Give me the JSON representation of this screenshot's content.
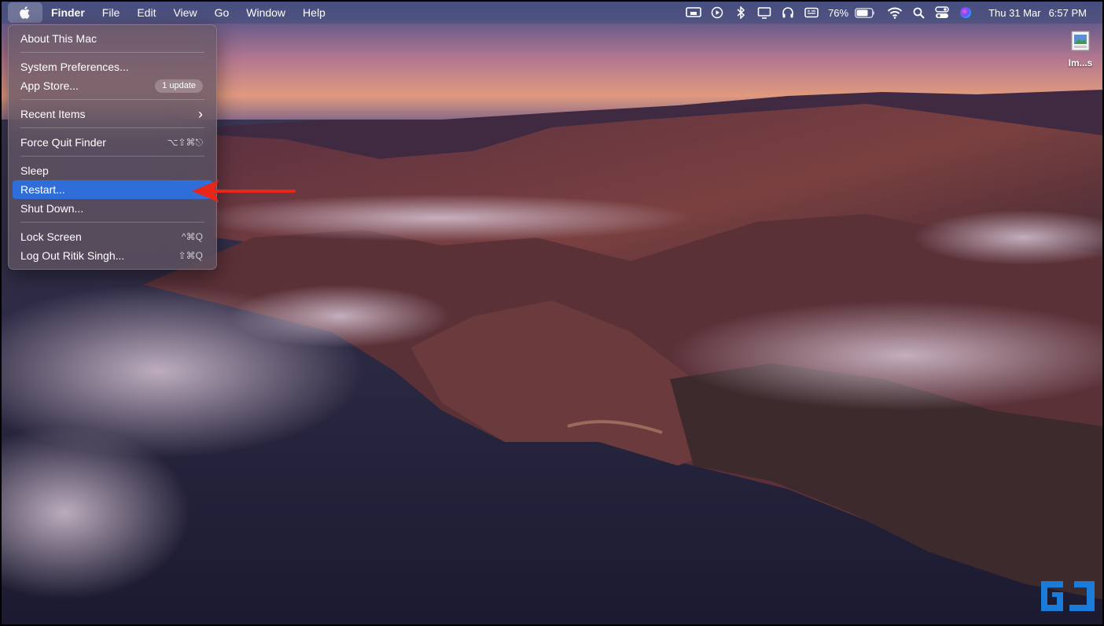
{
  "menubar": {
    "app_name": "Finder",
    "menus": [
      "File",
      "Edit",
      "View",
      "Go",
      "Window",
      "Help"
    ],
    "status": {
      "battery_percent": "76%",
      "date": "Thu 31 Mar",
      "time": "6:57 PM"
    }
  },
  "apple_menu": {
    "items": [
      {
        "label": "About This Mac"
      },
      {
        "label": "System Preferences..."
      },
      {
        "label": "App Store...",
        "badge": "1 update"
      },
      {
        "label": "Recent Items",
        "arrow": "›"
      },
      {
        "label": "Force Quit Finder",
        "shortcut": "⌥⇧⌘⎋"
      },
      {
        "label": "Sleep"
      },
      {
        "label": "Restart..."
      },
      {
        "label": "Shut Down..."
      },
      {
        "label": "Lock Screen",
        "shortcut": "^⌘Q"
      },
      {
        "label": "Log Out Ritik Singh...",
        "shortcut": "⇧⌘Q"
      }
    ]
  },
  "desktop": {
    "icon_label": "Im...s"
  },
  "colors": {
    "highlight": "#2f6ed8",
    "annotation_arrow": "#e8261a",
    "watermark": "#1a7bd8"
  }
}
